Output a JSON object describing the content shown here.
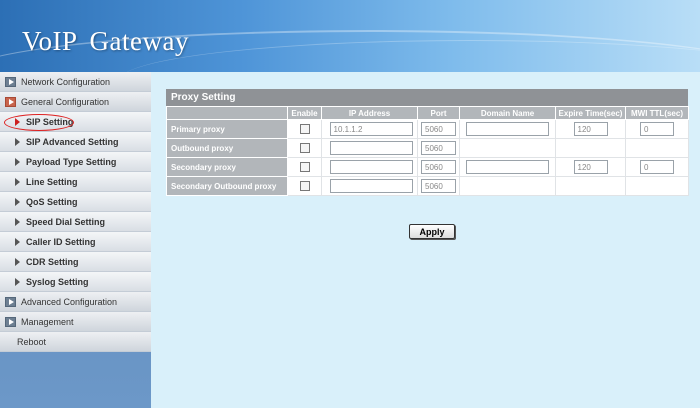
{
  "header": {
    "title_part1": "VoIP",
    "title_part2": "Gateway"
  },
  "sidebar": {
    "items": [
      {
        "label": "Network Configuration",
        "type": "top"
      },
      {
        "label": "General Configuration",
        "type": "top-open"
      },
      {
        "label": "SIP Setting",
        "type": "sub-active"
      },
      {
        "label": "SIP Advanced Setting",
        "type": "sub"
      },
      {
        "label": "Payload Type Setting",
        "type": "sub"
      },
      {
        "label": "Line Setting",
        "type": "sub"
      },
      {
        "label": "QoS Setting",
        "type": "sub"
      },
      {
        "label": "Speed Dial Setting",
        "type": "sub"
      },
      {
        "label": "Caller ID Setting",
        "type": "sub"
      },
      {
        "label": "CDR Setting",
        "type": "sub"
      },
      {
        "label": "Syslog Setting",
        "type": "sub"
      },
      {
        "label": "Advanced Configuration",
        "type": "top"
      },
      {
        "label": "Management",
        "type": "top"
      },
      {
        "label": "Reboot",
        "type": "plain"
      }
    ]
  },
  "panel": {
    "title": "Proxy Setting",
    "columns": [
      "",
      "Enable",
      "IP Address",
      "Port",
      "Domain Name",
      "Expire Time(sec)",
      "MWI TTL(sec)"
    ],
    "rows": [
      {
        "label": "Primary proxy",
        "ip": "10.1.1.2",
        "port": "5060",
        "domain": "",
        "expire": "120",
        "mwi": "0"
      },
      {
        "label": "Outbound proxy",
        "ip": "",
        "port": "5060"
      },
      {
        "label": "Secondary proxy",
        "ip": "",
        "port": "5060",
        "domain": "",
        "expire": "120",
        "mwi": "0"
      },
      {
        "label": "Secondary Outbound proxy",
        "ip": "",
        "port": "5060"
      }
    ]
  },
  "actions": {
    "apply_label": "Apply"
  },
  "colors": {
    "header_blue": "#2c6fb5",
    "sidebar_blue": "#5d86b8",
    "main_bg": "#d9f0fa",
    "panel_title_bg": "#8f9296",
    "highlight_circle": "#dd2222"
  }
}
